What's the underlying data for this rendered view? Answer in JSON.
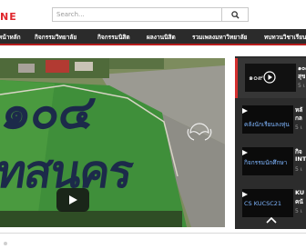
{
  "header": {
    "brand_text": "NE",
    "search_placeholder": "Search..."
  },
  "nav": {
    "items": [
      "หน้าหลัก",
      "กิจกรรมวิทยาลัย",
      "กิจกรรมนิสิต",
      "ผลงานนิสิต",
      "รวมเพลงมหาวิทยาลัย",
      "ทบทวนวิชาเรียน"
    ]
  },
  "video": {
    "big_text_top": "๑๐๔",
    "big_text_bottom": "ทสนคร"
  },
  "playlist": {
    "items": [
      {
        "title": "๑๐๙",
        "title2": "สุข",
        "sub": "5 เ",
        "thumb_caption": "",
        "active": true
      },
      {
        "title": "หลั",
        "title2": "กล",
        "sub": "5 เ",
        "thumb_caption": "คลังนักเรียนลงหุ่น",
        "active": false
      },
      {
        "title": "กิจ",
        "title2": "INT",
        "sub": "5 เ",
        "thumb_caption": "กิจกรรมนักศึกษา",
        "active": false
      },
      {
        "title": "KU",
        "title2": "คนั",
        "sub": "5 เ",
        "thumb_caption": "CS KUCSC21",
        "active": false
      }
    ]
  },
  "colors": {
    "accent": "#d32f2f",
    "nav_bg": "#2b2b2b",
    "playlist_bg": "#2c2c2c"
  }
}
